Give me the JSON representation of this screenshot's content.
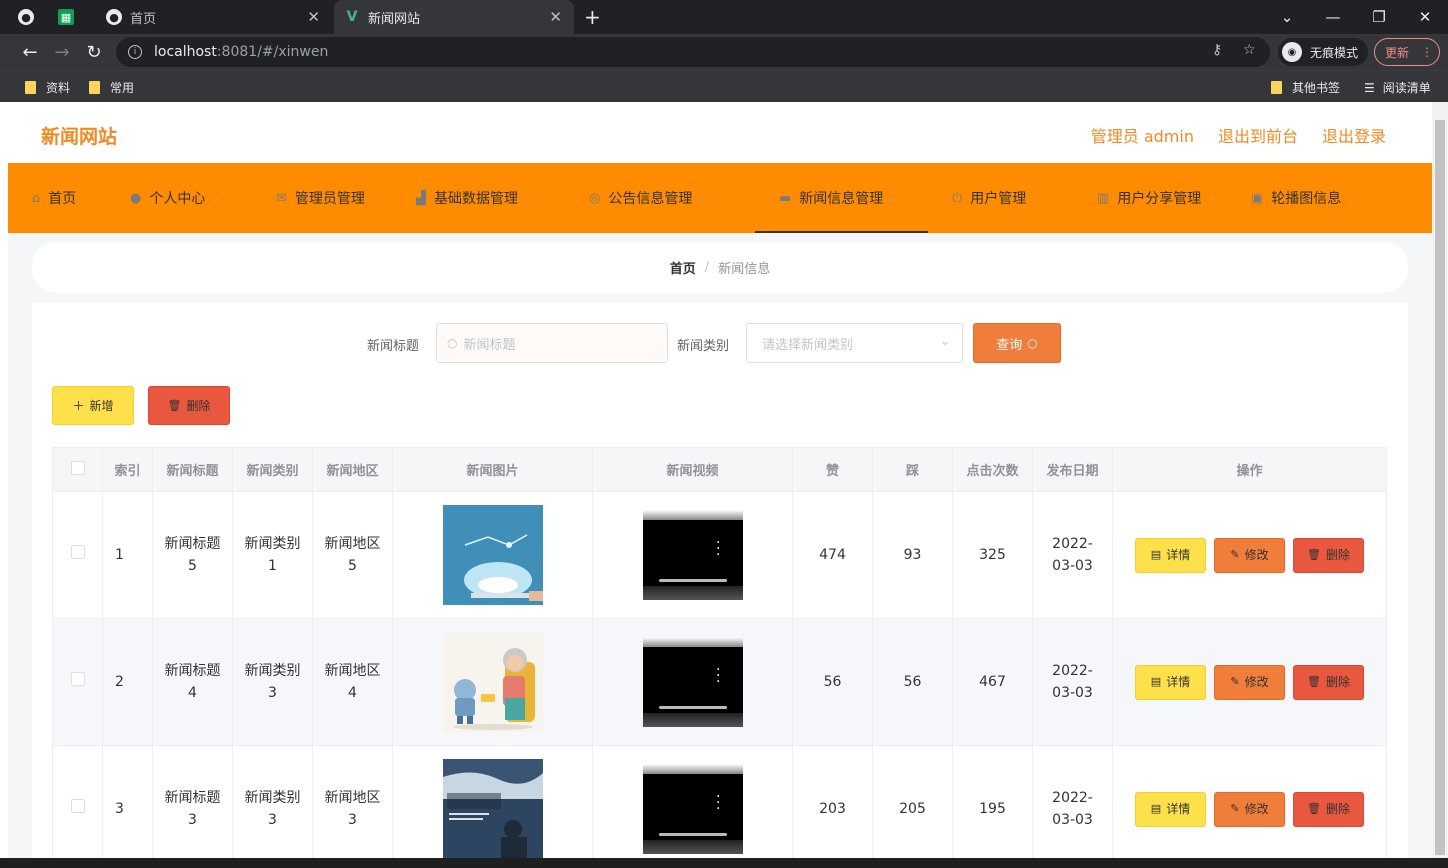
{
  "browser": {
    "tabs": [
      {
        "title": ""
      },
      {
        "title": ""
      },
      {
        "title": "首页"
      },
      {
        "title": "新闻网站"
      }
    ],
    "new_tab": "+",
    "url_host": "localhost",
    "url_rest": ":8081/#/xinwen",
    "incognito": "无痕模式",
    "update": "更新",
    "bookmarks": [
      "资料",
      "常用"
    ],
    "bookmarks_right": [
      "其他书签",
      "阅读清单"
    ]
  },
  "header": {
    "brand": "新闻网站",
    "links": [
      "管理员 admin",
      "退出到前台",
      "退出登录"
    ]
  },
  "menu": [
    {
      "label": "首页",
      "icon": "home-icon"
    },
    {
      "label": "个人中心",
      "icon": "user-icon"
    },
    {
      "label": "管理员管理",
      "icon": "mail-icon"
    },
    {
      "label": "基础数据管理",
      "icon": "chart-icon"
    },
    {
      "label": "公告信息管理",
      "icon": "circle-icon"
    },
    {
      "label": "新闻信息管理",
      "icon": "chat-icon"
    },
    {
      "label": "用户管理",
      "icon": "power-icon"
    },
    {
      "label": "用户分享管理",
      "icon": "book-icon"
    },
    {
      "label": "轮播图信息",
      "icon": "picture-icon"
    }
  ],
  "breadcrumb": {
    "home": "首页",
    "sep": "/",
    "current": "新闻信息"
  },
  "search": {
    "title_label": "新闻标题",
    "title_placeholder": "新闻标题",
    "type_label": "新闻类别",
    "type_placeholder": "请选择新闻类别",
    "query": "查询"
  },
  "actions": {
    "add": "新增",
    "delete": "删除"
  },
  "table": {
    "headers": [
      "索引",
      "新闻标题",
      "新闻类别",
      "新闻地区",
      "新闻图片",
      "新闻视频",
      "赞",
      "踩",
      "点击次数",
      "发布日期",
      "操作"
    ],
    "rows": [
      {
        "index": "1",
        "title": "新闻标题5",
        "type": "新闻类别1",
        "region": "新闻地区5",
        "likes": "474",
        "dislikes": "93",
        "clicks": "325",
        "date": "2022-03-03"
      },
      {
        "index": "2",
        "title": "新闻标题4",
        "type": "新闻类别3",
        "region": "新闻地区4",
        "likes": "56",
        "dislikes": "56",
        "clicks": "467",
        "date": "2022-03-03"
      },
      {
        "index": "3",
        "title": "新闻标题3",
        "type": "新闻类别3",
        "region": "新闻地区3",
        "likes": "203",
        "dislikes": "205",
        "clicks": "195",
        "date": "2022-03-03"
      }
    ],
    "ops": {
      "detail": "详情",
      "edit": "修改",
      "delete": "删除"
    }
  },
  "colors": {
    "accent": "#ff8c00",
    "brand": "#f08a24",
    "yellow": "#fde04a",
    "orange": "#f07d3a",
    "red": "#e8573e"
  }
}
